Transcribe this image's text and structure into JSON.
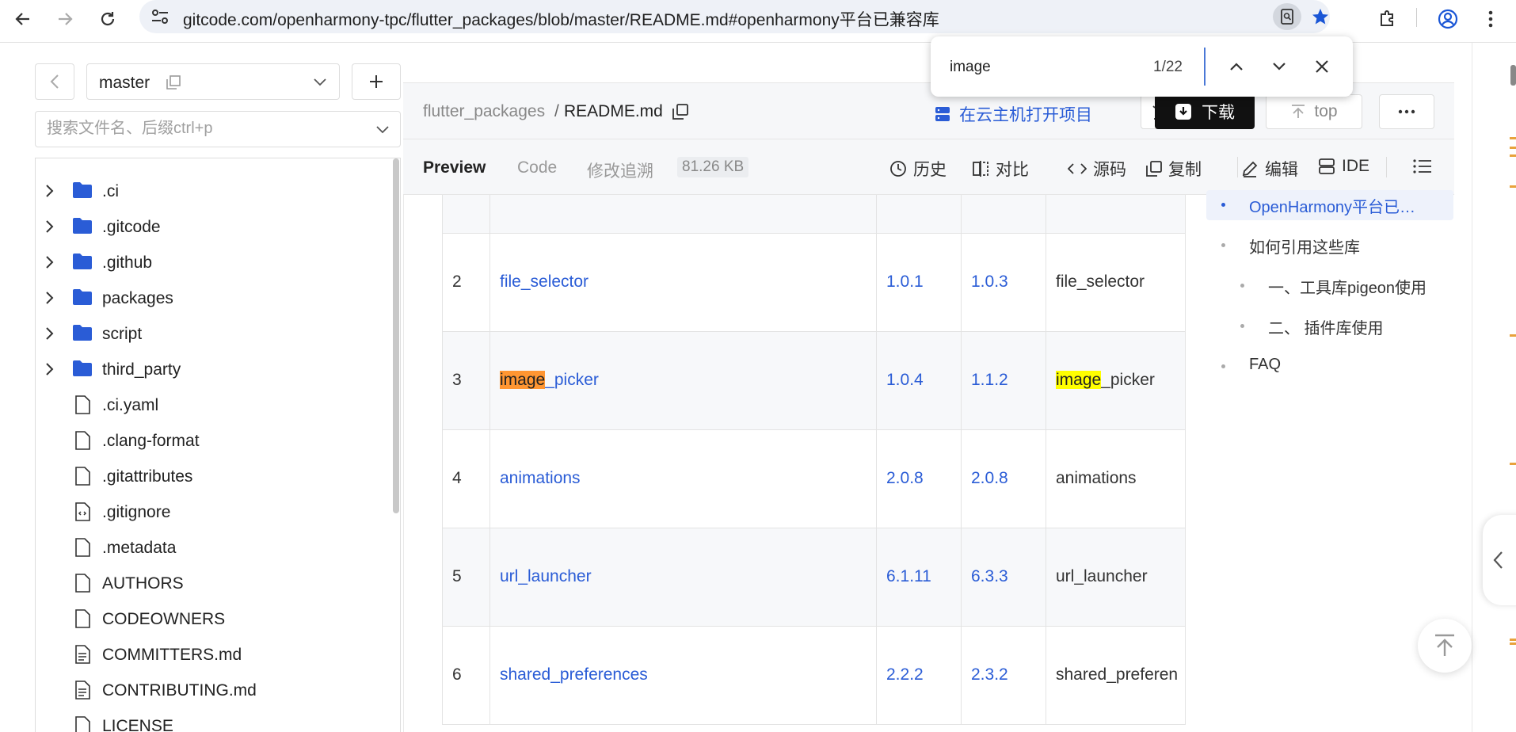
{
  "browser": {
    "url_host": "gitcode.com",
    "url_path": "/openharmony-tpc/flutter_packages/blob/master/README.md#openharmony平台已兼容库"
  },
  "find_bar": {
    "query": "image",
    "count": "1/22"
  },
  "sidebar": {
    "branch": "master",
    "search_placeholder": "搜索文件名、后缀ctrl+p",
    "tree": [
      {
        "name": ".ci",
        "type": "folder"
      },
      {
        "name": ".gitcode",
        "type": "folder"
      },
      {
        "name": ".github",
        "type": "folder"
      },
      {
        "name": "packages",
        "type": "folder"
      },
      {
        "name": "script",
        "type": "folder"
      },
      {
        "name": "third_party",
        "type": "folder"
      },
      {
        "name": ".ci.yaml",
        "type": "file"
      },
      {
        "name": ".clang-format",
        "type": "file"
      },
      {
        "name": ".gitattributes",
        "type": "file"
      },
      {
        "name": ".gitignore",
        "type": "code-file"
      },
      {
        "name": ".metadata",
        "type": "file"
      },
      {
        "name": "AUTHORS",
        "type": "file"
      },
      {
        "name": "CODEOWNERS",
        "type": "file"
      },
      {
        "name": "COMMITTERS.md",
        "type": "doc-file"
      },
      {
        "name": "CONTRIBUTING.md",
        "type": "doc-file"
      },
      {
        "name": "LICENSE",
        "type": "file"
      }
    ]
  },
  "file_header": {
    "repo": "flutter_packages",
    "separator": "/",
    "file": "README.md",
    "cloud_link": "在云主机打开项目",
    "download": "下载",
    "top": "top"
  },
  "toolbar": {
    "tabs": [
      "Preview",
      "Code",
      "修改追溯"
    ],
    "size": "81.26 KB",
    "actions": [
      "历史",
      "对比",
      "源码",
      "复制",
      "编辑",
      "IDE"
    ]
  },
  "table": {
    "rows": [
      {
        "no": "2",
        "name_pre": "",
        "name_hl": "",
        "name_post": "file_selector",
        "v1": "1.0.1",
        "v2": "1.0.3",
        "pkg_pre": "",
        "pkg_hl": "",
        "pkg_post": "file_selector"
      },
      {
        "no": "3",
        "name_pre": "",
        "name_hl": "image",
        "name_post": "_picker",
        "v1": "1.0.4",
        "v2": "1.1.2",
        "pkg_pre": "",
        "pkg_hl": "image",
        "pkg_post": "_picker"
      },
      {
        "no": "4",
        "name_pre": "",
        "name_hl": "",
        "name_post": "animations",
        "v1": "2.0.8",
        "v2": "2.0.8",
        "pkg_pre": "",
        "pkg_hl": "",
        "pkg_post": "animations"
      },
      {
        "no": "5",
        "name_pre": "",
        "name_hl": "",
        "name_post": "url_launcher",
        "v1": "6.1.11",
        "v2": "6.3.3",
        "pkg_pre": "",
        "pkg_hl": "",
        "pkg_post": "url_launcher"
      },
      {
        "no": "6",
        "name_pre": "",
        "name_hl": "",
        "name_post": "shared_preferences",
        "v1": "2.2.2",
        "v2": "2.3.2",
        "pkg_pre": "",
        "pkg_hl": "",
        "pkg_post": "shared_preferen"
      }
    ]
  },
  "toc": [
    {
      "label": "OpenHarmony平台已…",
      "level": 1,
      "active": true
    },
    {
      "label": "如何引用这些库",
      "level": 1,
      "active": false
    },
    {
      "label": "一、工具库pigeon使用",
      "level": 2,
      "active": false
    },
    {
      "label": "二、 插件库使用",
      "level": 2,
      "active": false
    },
    {
      "label": "FAQ",
      "level": 1,
      "active": false
    }
  ],
  "colors": {
    "link": "#2a5cd6",
    "highlight_active": "#ff9632",
    "highlight": "#ffff00",
    "folder": "#2a5cd6"
  }
}
